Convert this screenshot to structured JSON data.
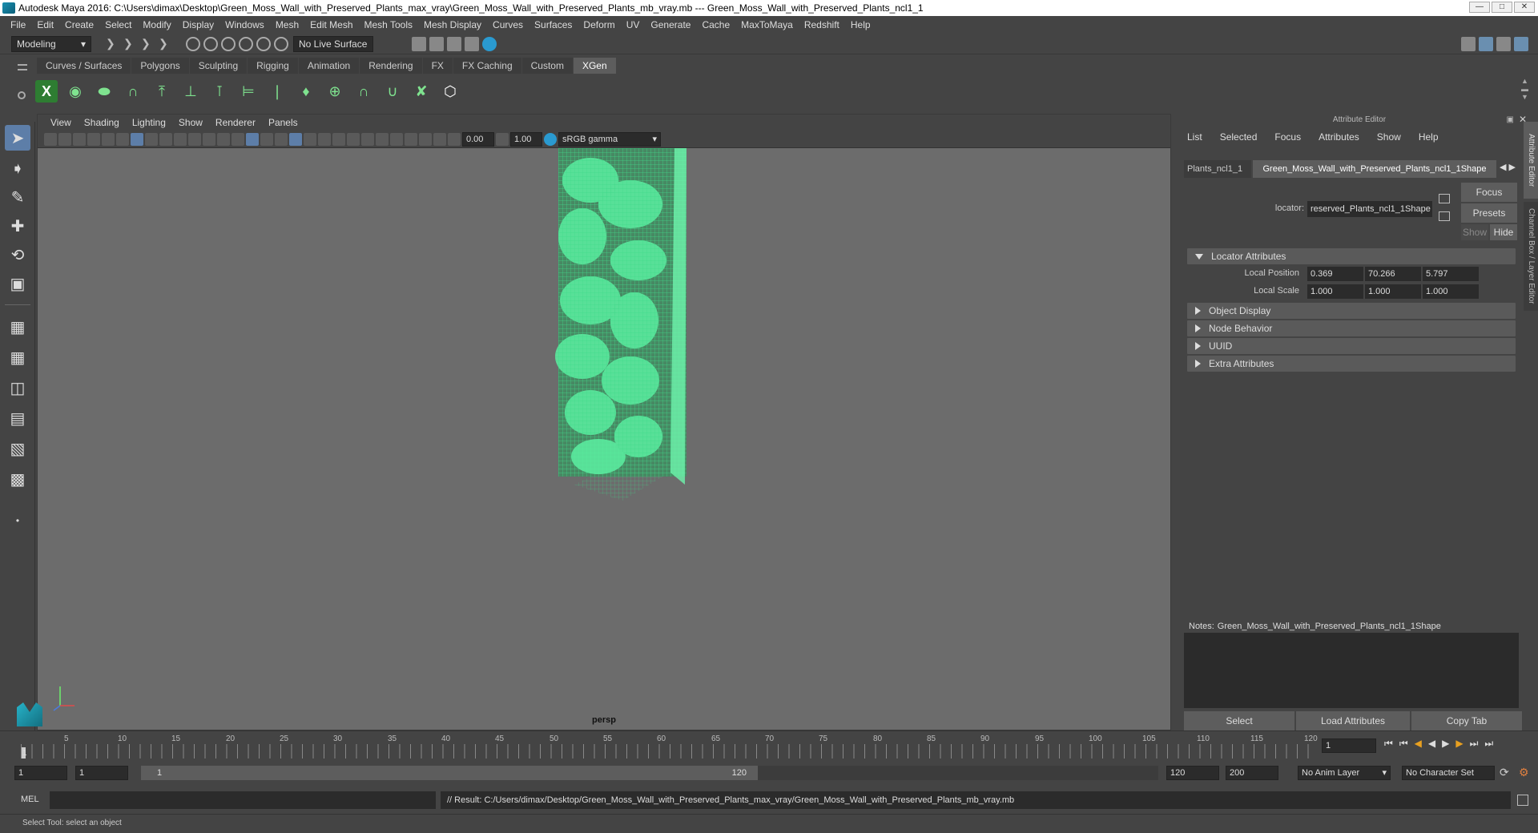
{
  "window": {
    "title": "Autodesk Maya 2016: C:\\Users\\dimax\\Desktop\\Green_Moss_Wall_with_Preserved_Plants_max_vray\\Green_Moss_Wall_with_Preserved_Plants_mb_vray.mb  ---  Green_Moss_Wall_with_Preserved_Plants_ncl1_1",
    "min": "—",
    "max": "□",
    "close": "✕"
  },
  "menu": [
    "File",
    "Edit",
    "Create",
    "Select",
    "Modify",
    "Display",
    "Windows",
    "Mesh",
    "Edit Mesh",
    "Mesh Tools",
    "Mesh Display",
    "Curves",
    "Surfaces",
    "Deform",
    "UV",
    "Generate",
    "Cache",
    "MaxToMaya",
    "Redshift",
    "Help"
  ],
  "status": {
    "mode": "Modeling",
    "live_surface": "No Live Surface"
  },
  "shelf_tabs": [
    "Curves / Surfaces",
    "Polygons",
    "Sculpting",
    "Rigging",
    "Animation",
    "Rendering",
    "FX",
    "FX Caching",
    "Custom",
    "XGen"
  ],
  "shelf_active": "XGen",
  "viewport": {
    "menu": [
      "View",
      "Shading",
      "Lighting",
      "Show",
      "Renderer",
      "Panels"
    ],
    "exposure": "0.00",
    "gamma": "1.00",
    "colorspace": "sRGB gamma",
    "camera": "persp"
  },
  "attribute_editor": {
    "title": "Attribute Editor",
    "menu": [
      "List",
      "Selected",
      "Focus",
      "Attributes",
      "Show",
      "Help"
    ],
    "tab_left": "Plants_ncl1_1",
    "tab_right": "Green_Moss_Wall_with_Preserved_Plants_ncl1_1Shape",
    "locator_label": "locator:",
    "locator_value": "reserved_Plants_ncl1_1Shape",
    "focus_btn": "Focus",
    "presets_btn": "Presets",
    "show_btn": "Show",
    "hide_btn": "Hide",
    "section_locator": "Locator Attributes",
    "local_position_label": "Local Position",
    "local_position": [
      "0.369",
      "70.266",
      "5.797"
    ],
    "local_scale_label": "Local Scale",
    "local_scale": [
      "1.000",
      "1.000",
      "1.000"
    ],
    "sections": [
      "Object Display",
      "Node Behavior",
      "UUID",
      "Extra Attributes"
    ],
    "notes_label": "Notes:",
    "notes_value": "Green_Moss_Wall_with_Preserved_Plants_ncl1_1Shape",
    "btn_select": "Select",
    "btn_load": "Load Attributes",
    "btn_copy": "Copy Tab",
    "side_tabs": [
      "Attribute Editor",
      "Channel Box / Layer Editor"
    ]
  },
  "timeline": {
    "ticks": [
      "5",
      "10",
      "15",
      "20",
      "25",
      "30",
      "35",
      "40",
      "45",
      "50",
      "55",
      "60",
      "65",
      "70",
      "75",
      "80",
      "85",
      "90",
      "95",
      "100",
      "105",
      "110",
      "115",
      "120"
    ],
    "current_marker": "1",
    "current_frame": "1"
  },
  "range": {
    "start": "1",
    "start2": "1",
    "slider_start": "1",
    "slider_end": "120",
    "end": "120",
    "end2": "200",
    "anim_layer": "No Anim Layer",
    "char_set": "No Character Set"
  },
  "cmd": {
    "lang": "MEL",
    "result": "// Result: C:/Users/dimax/Desktop/Green_Moss_Wall_with_Preserved_Plants_max_vray/Green_Moss_Wall_with_Preserved_Plants_mb_vray.mb"
  },
  "help": "Select Tool: select an object",
  "colors": {
    "bg": "#444444",
    "viewport": "#6c6c6c",
    "wire": "#4fe89a",
    "accent": "#5d5d5d"
  }
}
